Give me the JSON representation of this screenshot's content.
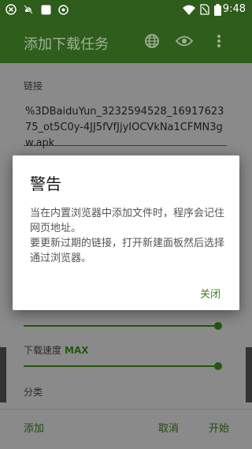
{
  "status_bar": {
    "time": "9:48",
    "icons": [
      "close-circle-icon",
      "notification-off-icon",
      "square-icon",
      "shield-icon",
      "wifi-icon",
      "no-sim-icon",
      "battery-icon"
    ]
  },
  "toolbar": {
    "title": "添加下载任务",
    "actions": [
      "globe-icon",
      "eye-icon",
      "more-vert-icon"
    ]
  },
  "form": {
    "link_label": "链接",
    "link_value": "%3DBaiduYun_3232594528_1691762375_ot5C0y-4JJ5fVfJjyIOCVkNa1CFMN3gw.apk",
    "thread_label_fragment": "",
    "speed_label": "下载速度",
    "speed_value": "MAX",
    "category_label": "分类"
  },
  "bottom_bar": {
    "add": "添加",
    "cancel": "取消",
    "start": "开始"
  },
  "dialog": {
    "title": "警告",
    "message": "当在内置浏览器中添加文件时，程序会记住网页地址。\n要更新过期的链接，打开新建面板然后选择通过浏览器。",
    "close": "关闭"
  },
  "colors": {
    "primary": "#2f5d1b",
    "accent": "#3e7d24",
    "dim_overlay": "#8a8a8a"
  }
}
